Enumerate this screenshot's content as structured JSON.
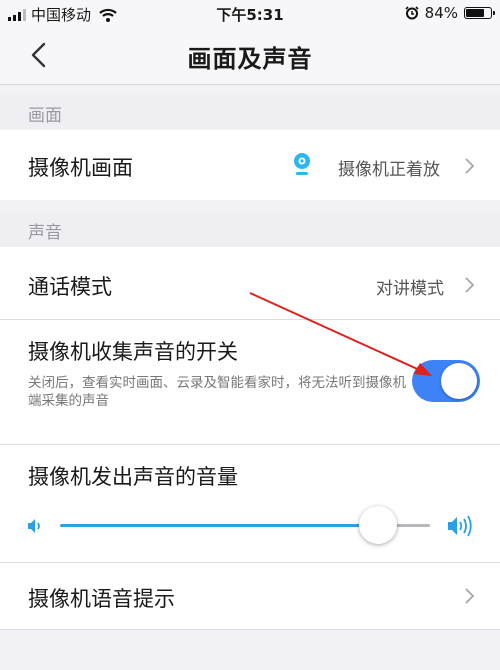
{
  "status_bar": {
    "carrier": "中国移动",
    "time": "下午5:31",
    "battery": "84%",
    "battery_level": 0.84
  },
  "nav": {
    "title": "画面及声音"
  },
  "sections": {
    "picture_header": "画面",
    "sound_header": "声音"
  },
  "rows": {
    "camera_picture": {
      "label": "摄像机画面",
      "value": "摄像机正着放"
    },
    "call_mode": {
      "label": "通话模式",
      "value": "对讲模式"
    },
    "sound_capture": {
      "label": "摄像机收集声音的开关",
      "description": "关闭后，查看实时画面、云录及智能看家时，将无法听到摄像机端采集的声音",
      "enabled": true
    },
    "volume": {
      "label": "摄像机发出声音的音量",
      "level": 0.86
    },
    "voice_prompt": {
      "label": "摄像机语音提示"
    }
  },
  "colors": {
    "accent": "#3e82f7",
    "slider": "#2a9fe3",
    "arrow": "#e0201c"
  },
  "icons": {
    "camera": "camera-icon",
    "volume_low": "volume-low-icon",
    "volume_high": "volume-high-icon"
  }
}
